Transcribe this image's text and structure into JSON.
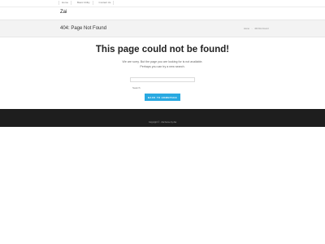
{
  "topnav": {
    "items": [
      "Home",
      "Basic Utility",
      "Contact Us"
    ]
  },
  "site": {
    "logo": "Zai"
  },
  "titlebar": {
    "title": "404: Page Not Found",
    "breadcrumb": [
      "Home",
      "404 Not Found"
    ]
  },
  "main": {
    "heading": "This page could not be found!",
    "message_line1": "We are sorry. But the page you are looking for is not available.",
    "message_line2": "Perhaps you can try a new search.",
    "search_placeholder": "Search",
    "back_button": "BACK TO HOMEPAGE"
  },
  "footer": {
    "copyright": "Copyright © · Zai theme by Zai"
  },
  "colors": {
    "accent": "#29a9e1",
    "footer_bg": "#1e1e1e",
    "titlebar_bg": "#f3f3f3"
  }
}
